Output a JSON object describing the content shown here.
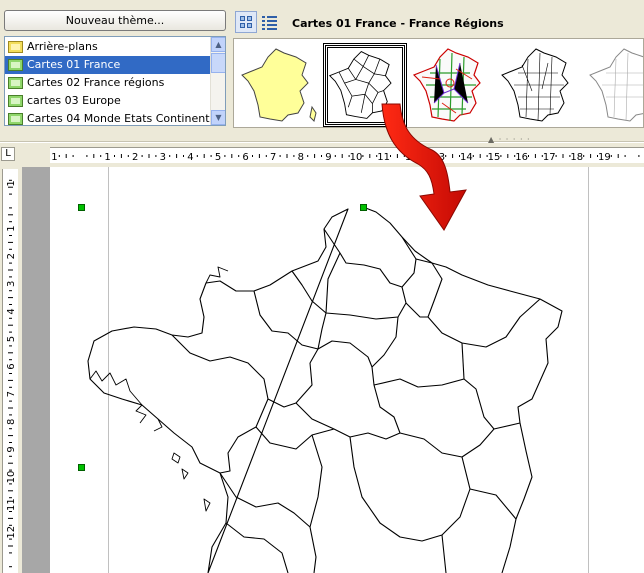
{
  "gallery": {
    "new_theme_label": "Nouveau thème...",
    "title": "Cartes 01 France  - France Régions",
    "themes": [
      {
        "label": "Arrière-plans",
        "icon": "folder-yellow-icon",
        "selected": false
      },
      {
        "label": "Cartes 01 France",
        "icon": "folder-green-icon",
        "selected": true
      },
      {
        "label": "Cartes 02 France régions",
        "icon": "folder-green-icon",
        "selected": false
      },
      {
        "label": "cartes 03  Europe",
        "icon": "folder-green-icon",
        "selected": false
      },
      {
        "label": "Cartes 04 Monde Etats Continents",
        "icon": "folder-green-icon",
        "selected": false
      }
    ],
    "view_modes": [
      "icon-view-icon",
      "detail-view-icon"
    ]
  },
  "ruler": {
    "horizontal_labels": [
      "1",
      "1",
      "2",
      "3",
      "4",
      "5",
      "6",
      "7",
      "8",
      "9",
      "10",
      "11",
      "12",
      "13",
      "14",
      "15",
      "16",
      "17",
      "18",
      "19"
    ],
    "vertical_labels": [
      "1",
      "1",
      "2",
      "3",
      "4",
      "5",
      "6",
      "7",
      "8",
      "9",
      "10",
      "11",
      "12"
    ],
    "corner_label": "L"
  },
  "colors": {
    "selection": "#316ac5",
    "handle": "#00c000",
    "arrow": "#e8100a",
    "thumb_fill_yellow": "#ffff99",
    "toolbar_bg": "#ece9d8"
  }
}
